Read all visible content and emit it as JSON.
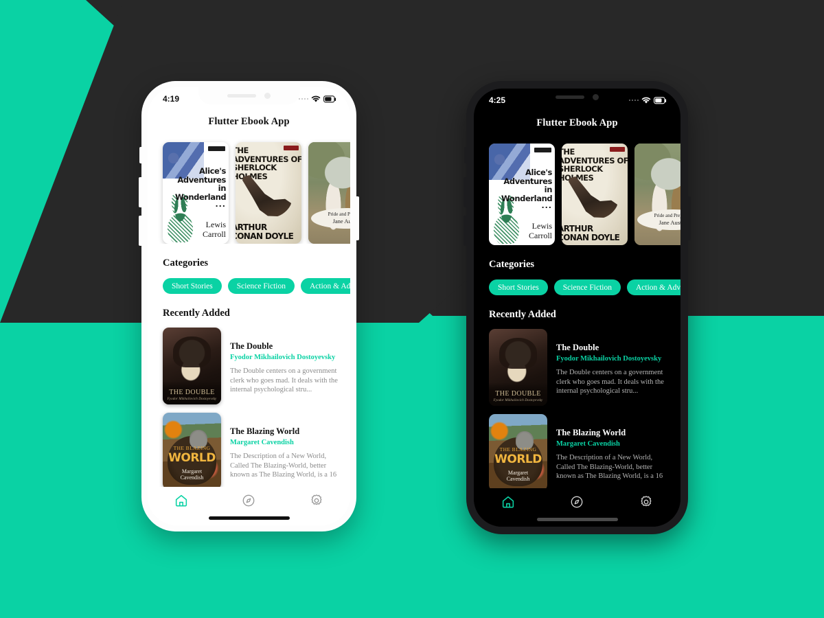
{
  "background": {
    "accent_color": "#0ad2a4",
    "dark_color": "#282828"
  },
  "theme": {
    "accent": "#0ad2a4",
    "light_bg": "#ffffff",
    "dark_bg": "#000000",
    "light_text": "#111111",
    "dark_text": "#ffffff",
    "muted_light": "#8b8b8b",
    "muted_dark": "#b4b4b4"
  },
  "phones": [
    {
      "id": "light",
      "mode": "Light",
      "status": {
        "time": "4:19",
        "signal_icon": "signal-dots-icon",
        "wifi_icon": "wifi-icon",
        "battery_icon": "battery-icon"
      }
    },
    {
      "id": "dark",
      "mode": "Dark",
      "status": {
        "time": "4:25",
        "signal_icon": "signal-dots-icon",
        "wifi_icon": "wifi-icon",
        "battery_icon": "battery-icon"
      }
    }
  ],
  "app": {
    "title": "Flutter Ebook App",
    "featured_heading": "",
    "categories_heading": "Categories",
    "recent_heading": "Recently Added",
    "featured": [
      {
        "title_lines": [
          "Alice's",
          "Adventures in",
          "Wonderland"
        ],
        "separator": "...",
        "author_lines": [
          "Lewis",
          "Carroll"
        ],
        "cover_name": "alice-in-wonderland-cover"
      },
      {
        "title_lines": [
          "THE",
          "ADVENTURES OF",
          "SHERLOCK HOLMES"
        ],
        "author_lines": [
          "ARTHUR",
          "CONAN DOYLE"
        ],
        "cover_name": "sherlock-holmes-cover"
      },
      {
        "title_lines": [
          "Pride and Prejudice"
        ],
        "author_lines": [
          "Jane Austen"
        ],
        "cover_name": "pride-and-prejudice-cover"
      }
    ],
    "categories": [
      {
        "label": "Short Stories"
      },
      {
        "label": "Science Fiction"
      },
      {
        "label": "Action & Adventure"
      }
    ],
    "recent": [
      {
        "title": "The Double",
        "author": "Fyodor Mikhailovich Dostoyevsky",
        "description": "The Double centers on a government clerk who goes mad. It deals with the internal psychological stru...",
        "cover_name": "the-double-cover",
        "cover_title": "The Double",
        "cover_author": "Fyodor Mikhailovich Dostoyevsky"
      },
      {
        "title": "The Blazing World",
        "author": "Margaret Cavendish",
        "description": "The Description of a New World, Called The Blazing-World, better known as The Blazing World, is a 16",
        "cover_name": "the-blazing-world-cover",
        "cover_title_small": "THE BLAZING",
        "cover_title_big": "WORLD",
        "cover_author_lines": [
          "Margaret",
          "Cavendish"
        ]
      }
    ],
    "nav": [
      {
        "icon": "home-icon",
        "active": true
      },
      {
        "icon": "explore-icon",
        "active": false
      },
      {
        "icon": "settings-icon",
        "active": false
      }
    ]
  }
}
